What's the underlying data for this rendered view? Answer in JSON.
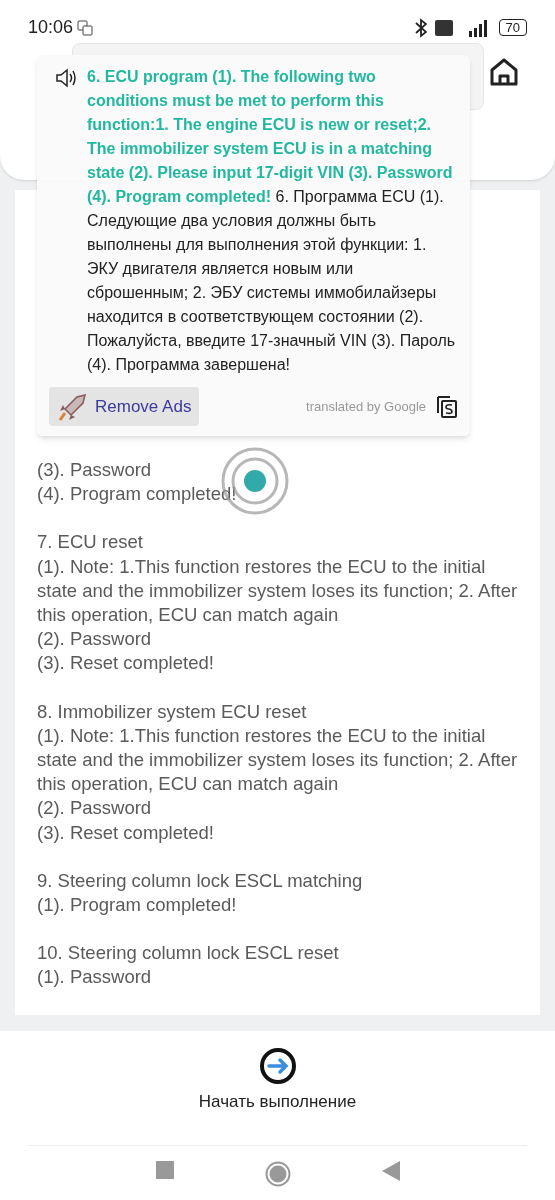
{
  "status_bar": {
    "time": "10:06",
    "battery": "70"
  },
  "translation_popup": {
    "source_text": "6. ECU program (1). The following two conditions must be met to perform this function:1. The engine ECU is new or reset;2. The immobilizer system ECU is in a matching state (2). Please input 17-digit VIN (3). Password (4). Program completed!",
    "translated_text": "6. Программа ECU (1). Следующие два условия должны быть выполнены для выполнения этой функции: 1. ЭКУ двигателя является новым или сброшенным; 2. ЭБУ системы иммобилайзеры находится в соответствующем состоянии (2). Пожалуйста, введите 17-значный VIN (3). Пароль (4). Программа завершена!",
    "remove_ads": "Remove Ads",
    "attribution": "translated by Google"
  },
  "content": [
    {
      "lines": [
        "(3). Password",
        "(4). Program completed!"
      ]
    },
    {
      "lines": [
        "7. ECU reset",
        "(1). Note: 1.This function restores the ECU to the initial state and the immobilizer system loses its function; 2. After this operation, ECU can match again",
        "(2). Password",
        "(3). Reset completed!"
      ]
    },
    {
      "lines": [
        "8. Immobilizer system ECU  reset",
        "(1). Note: 1.This function restores the ECU to the initial state and the immobilizer system loses its function; 2. After this operation, ECU can match again",
        "(2). Password",
        "(3). Reset completed!"
      ]
    },
    {
      "lines": [
        "9. Steering column lock ESCL matching",
        "(1). Program completed!"
      ]
    },
    {
      "lines": [
        "10. Steering column lock ESCL reset",
        "(1). Password"
      ]
    }
  ],
  "start_button": "Начать выполнение"
}
